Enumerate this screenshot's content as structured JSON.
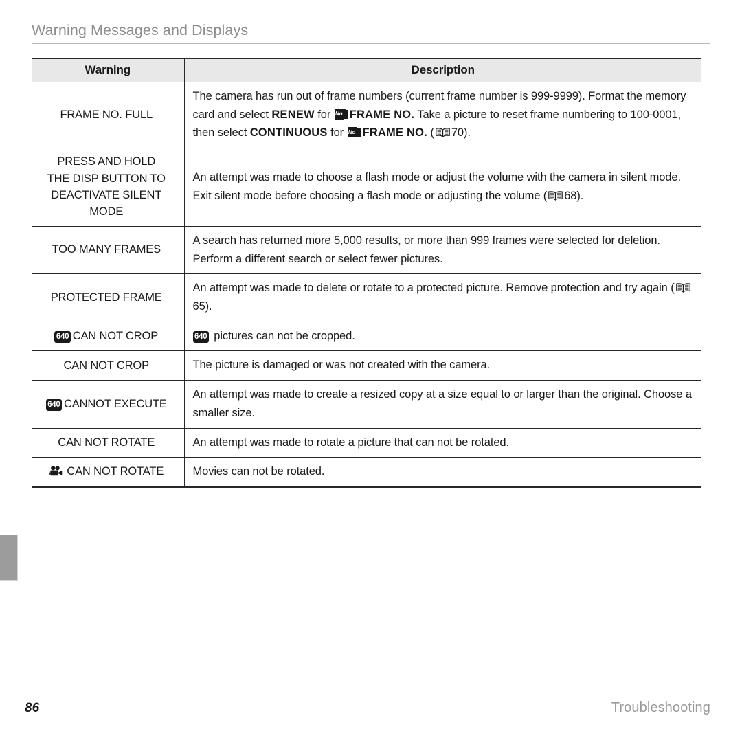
{
  "header": {
    "title": "Warning Messages and Displays"
  },
  "table": {
    "columns": {
      "warning": "Warning",
      "description": "Description"
    },
    "rows": [
      {
        "warning": "FRAME NO. FULL",
        "desc_part1": "The camera has run out of frame numbers (current frame number is 999-9999).  Format the memory card and select ",
        "desc_bold1": "RENEW",
        "desc_part2": " for ",
        "icon1": "frame-no-icon",
        "desc_bold2": "FRAME NO.",
        "desc_part3": " Take a picture to reset frame numbering to 100-0001, then select ",
        "desc_bold3": "CONTINUOUS",
        "desc_part4": " for ",
        "icon2": "frame-no-icon",
        "desc_bold4": "FRAME NO.",
        "desc_part5": " (",
        "icon3": "book-icon",
        "page_ref": "70",
        "desc_part6": ")."
      },
      {
        "warning_line1": "PRESS AND HOLD",
        "warning_line2": "THE DISP BUTTON TO",
        "warning_line3": "DEACTIVATE SILENT MODE",
        "desc_part1": "An attempt was made to choose a flash mode or adjust the volume with the camera in silent mode.  Exit silent mode before choosing a flash mode or adjusting the volume (",
        "icon1": "book-icon",
        "page_ref": "68",
        "desc_part2": ")."
      },
      {
        "warning": "TOO MANY FRAMES",
        "desc_part1": "A search has returned more 5,000 results, or more than 999 frames were selected for deletion. Perform a different search or select fewer pictures."
      },
      {
        "warning": "PROTECTED FRAME",
        "desc_part1": "An attempt was made to delete or rotate to a protected picture.  Remove protection and try again (",
        "icon1": "book-icon",
        "page_ref": "65",
        "desc_part2": ")."
      },
      {
        "warning_icon": "640-icon",
        "warning": "CAN NOT CROP",
        "desc_icon": "640-icon",
        "desc_part1": " pictures can not be cropped."
      },
      {
        "warning": "CAN NOT CROP",
        "desc_part1": "The picture is damaged or was not created with the camera."
      },
      {
        "warning_icon": "640-icon",
        "warning": "CANNOT EXECUTE",
        "desc_part1": "An attempt was made to create a resized copy at a size equal to or larger than the original. Choose a smaller size."
      },
      {
        "warning": "CAN NOT ROTATE",
        "desc_part1": "An attempt was made to rotate a picture that can not be rotated."
      },
      {
        "warning_icon": "movie-camera-icon",
        "warning": "CAN NOT ROTATE",
        "desc_part1": "Movies can not be rotated."
      }
    ]
  },
  "icons": {
    "frame_no_label": "No",
    "size_640_label": "640"
  },
  "footer": {
    "page_number": "86",
    "section": "Troubleshooting"
  },
  "colors": {
    "header_text": "#8d8d8d",
    "rule": "#b9b9b9",
    "table_border": "#2b2530",
    "header_fill": "#e8e8e8",
    "side_tab": "#9c9c9c",
    "body_text": "#1a1a1a"
  }
}
